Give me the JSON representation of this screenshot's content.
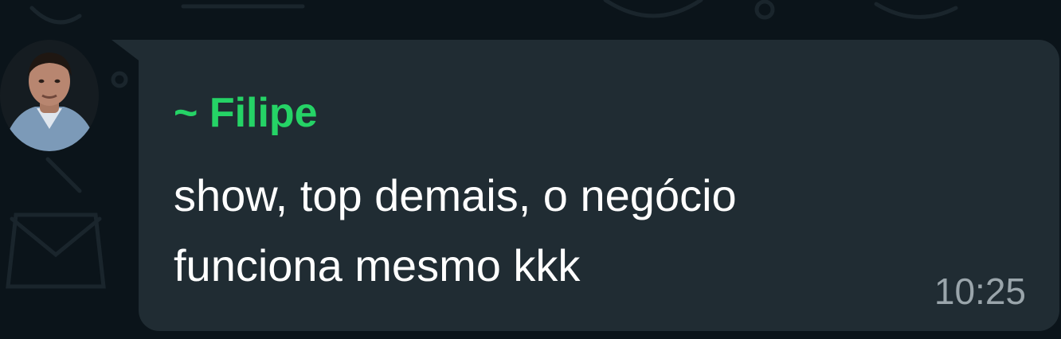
{
  "chat": {
    "message": {
      "sender_name": "~ Filipe",
      "text_lines": [
        "show, top demais, o negócio",
        "funciona mesmo kkk"
      ],
      "time": "10:25"
    },
    "avatar": {
      "icon": "user-photo"
    }
  },
  "colors": {
    "background": "#0b141a",
    "bubble": "#202c33",
    "sender_name": "#25d366",
    "message_text": "#ffffff",
    "timestamp": "#9aa5ab"
  }
}
